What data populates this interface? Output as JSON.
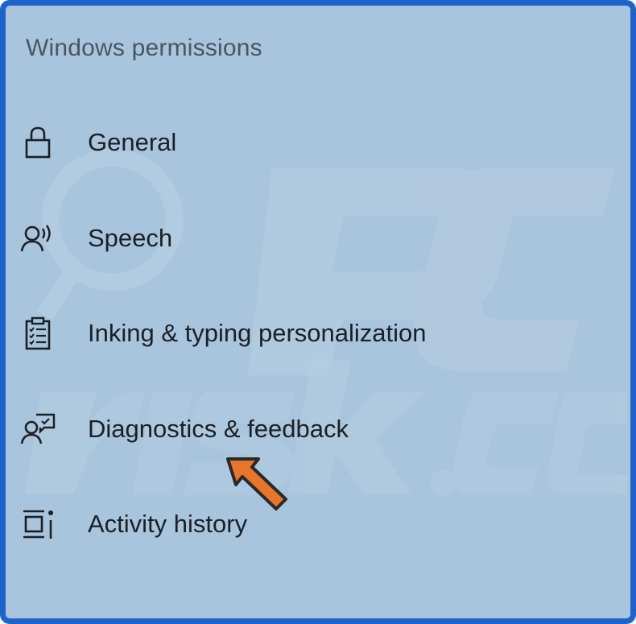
{
  "panel": {
    "section_title": "Windows permissions"
  },
  "menu": {
    "items": [
      {
        "label": "General",
        "icon": "lock-icon"
      },
      {
        "label": "Speech",
        "icon": "speech-person-icon"
      },
      {
        "label": "Inking & typing personalization",
        "icon": "clipboard-checklist-icon"
      },
      {
        "label": "Diagnostics & feedback",
        "icon": "person-feedback-icon"
      },
      {
        "label": "Activity history",
        "icon": "activity-timeline-icon"
      }
    ]
  },
  "annotation": {
    "arrow_color": "#e8762a"
  }
}
